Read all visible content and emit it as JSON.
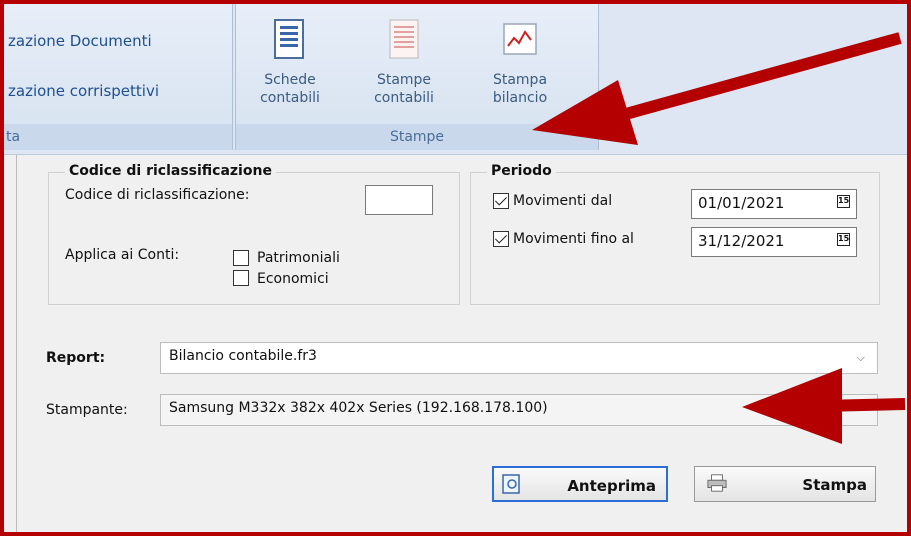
{
  "ribbon": {
    "menu_items": [
      "zazione Documenti",
      "zazione corrispettivi"
    ],
    "left_group_caption": "ta",
    "stampe_group": {
      "caption": "Stampe",
      "buttons": [
        {
          "line1": "Schede",
          "line2": "contabili",
          "icon": "document-icon"
        },
        {
          "line1": "Stampe",
          "line2": "contabili",
          "icon": "report-icon"
        },
        {
          "line1": "Stampa",
          "line2": "bilancio",
          "icon": "chart-icon"
        }
      ]
    }
  },
  "riclass": {
    "legend": "Codice di riclassificazione",
    "code_label": "Codice di riclassificazione:",
    "code_value": "",
    "apply_label": "Applica ai Conti:",
    "patrimoniali": {
      "label": "Patrimoniali",
      "checked": false
    },
    "economici": {
      "label": "Economici",
      "checked": false
    }
  },
  "periodo": {
    "legend": "Periodo",
    "dal": {
      "label": "Movimenti dal",
      "checked": true,
      "value": "01/01/2021"
    },
    "al": {
      "label": "Movimenti fino al",
      "checked": true,
      "value": "31/12/2021"
    },
    "calendar_glyph": "15"
  },
  "report": {
    "label": "Report:",
    "value": "Bilancio contabile.fr3"
  },
  "printer": {
    "label": "Stampante:",
    "value": "Samsung M332x 382x 402x Series (192.168.178.100)"
  },
  "actions": {
    "preview_label": "Anteprima",
    "print_label": "Stampa"
  },
  "colors": {
    "annotation_red": "#b40000",
    "ribbon_blue": "#dde6f2"
  }
}
